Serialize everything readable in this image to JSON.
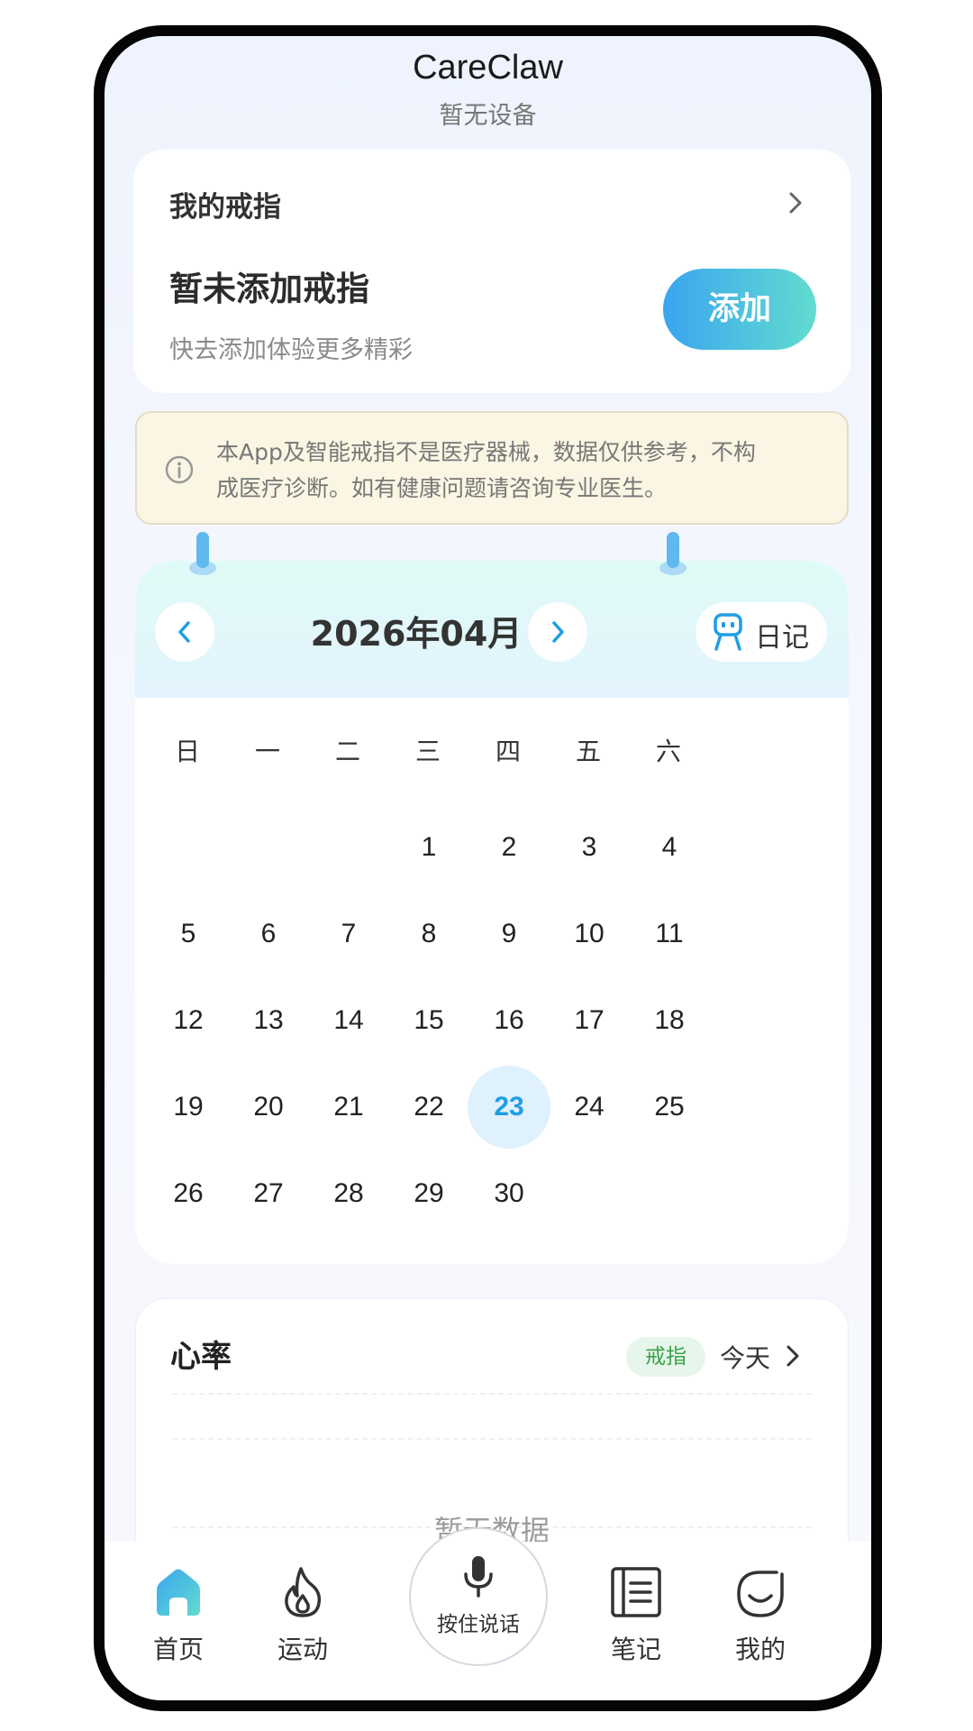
{
  "header": {
    "title": "CareClaw",
    "subtitle": "暂无设备"
  },
  "ring_card": {
    "title": "我的戒指",
    "headline": "暂未添加戒指",
    "description": "快去添加体验更多精彩",
    "add_label": "添加"
  },
  "notice": {
    "line1": "本App及智能戒指不是医疗器械，数据仅供参考，不构",
    "line2": "成医疗诊断。如有健康问题请咨询专业医生。"
  },
  "calendar": {
    "month_label": "2026年04月",
    "diary_label": "日记",
    "weekdays": [
      "日",
      "一",
      "二",
      "三",
      "四",
      "五",
      "六"
    ],
    "first_weekday": 3,
    "days_in_month": 30,
    "today": 23,
    "days": [
      "1",
      "2",
      "3",
      "4",
      "5",
      "6",
      "7",
      "8",
      "9",
      "10",
      "11",
      "12",
      "13",
      "14",
      "15",
      "16",
      "17",
      "18",
      "19",
      "20",
      "21",
      "22",
      "23",
      "24",
      "25",
      "26",
      "27",
      "28",
      "29",
      "30"
    ]
  },
  "heart_rate": {
    "title": "心率",
    "badge": "戒指",
    "range": "今天",
    "empty": "暂无数据"
  },
  "tabbar": {
    "home": "首页",
    "sport": "运动",
    "talk": "按住说话",
    "notes": "笔记",
    "me": "我的"
  },
  "colors": {
    "accent": "#1e9ee6",
    "add_gradient_start": "#3aa5ef",
    "add_gradient_end": "#62dccf",
    "badge_green": "#3aa24a"
  }
}
